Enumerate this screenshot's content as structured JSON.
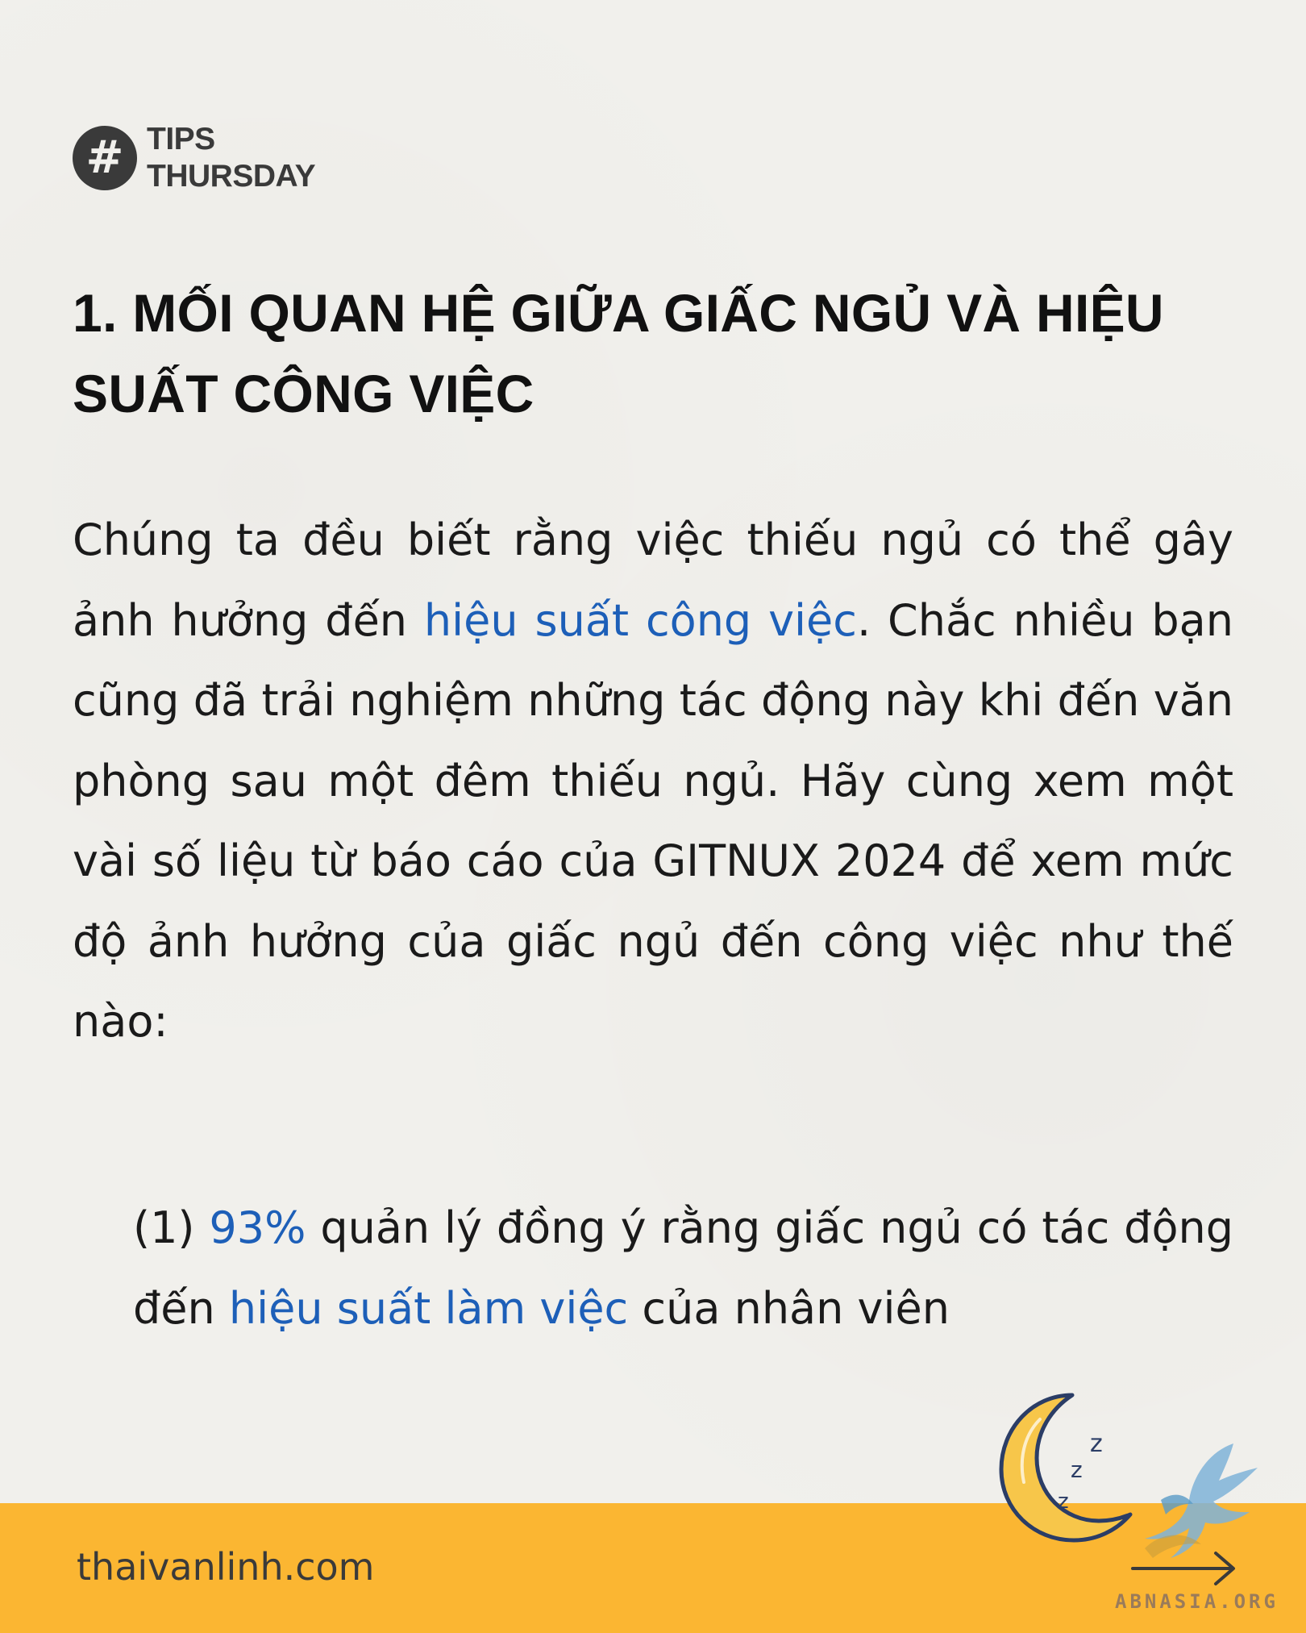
{
  "badge": {
    "icon": "hash-icon",
    "symbol": "#",
    "line1": "TIPS",
    "line2": "THURSDAY"
  },
  "heading": "1. MỐI QUAN HỆ GIỮA GIẤC NGỦ VÀ HIỆU SUẤT CÔNG VIỆC",
  "body": {
    "text_before": "Chúng ta đều biết rằng việc thiếu ngủ có thể gây ảnh hưởng đến ",
    "highlight": "hiệu suất công việc",
    "text_after": ". Chắc nhiều bạn cũng đã trải nghiệm những tác động này khi đến văn phòng sau một đêm thiếu ngủ. Hãy cùng xem một vài số liệu từ báo cáo của GITNUX 2024 để xem mức độ ảnh hưởng của giấc ngủ đến công việc như thế nào:"
  },
  "list_item": {
    "number": "(1) ",
    "stat": "93%",
    "text_mid": " quản lý đồng ý rằng giấc ngủ có tác động đến ",
    "highlight": "hiệu suất làm việc",
    "text_end": " của nhân viên"
  },
  "footer": {
    "url": "thaivanlinh.com",
    "arrow_icon": "arrow-right-icon"
  },
  "illustration": {
    "moon_icon": "sleeping-moon-icon",
    "zzz": [
      "z",
      "z",
      "z"
    ]
  },
  "watermark": {
    "text": "ABNASIA.ORG",
    "logo_icon": "dragon-logo-icon"
  },
  "colors": {
    "background": "#f1f0ec",
    "highlight": "#1d5fb8",
    "footer": "#fbb632",
    "badge": "#3a3a3a",
    "moon": "#f7c64a"
  }
}
